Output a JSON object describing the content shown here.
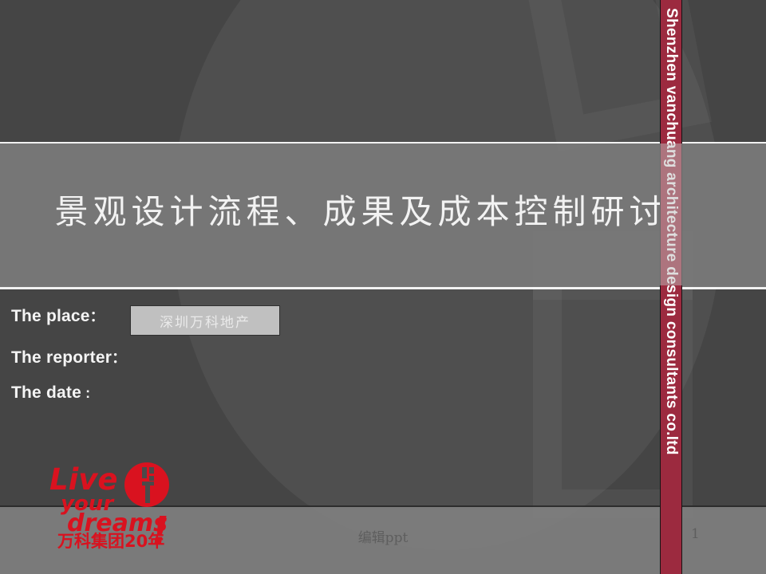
{
  "slide": {
    "title": "景观设计流程、成果及成本控制研讨",
    "background_color": "#454545",
    "band_color": "#7a7a7a",
    "accent_color": "#9c2a3f"
  },
  "side_banner": {
    "text": "Shenzhen  vanchuang architecture design consultants co.ltd",
    "color": "#9c2a3f",
    "text_color": "#ffffff"
  },
  "info": {
    "place_label": "The place",
    "place_colon": "：",
    "place_value": "深圳万科地产",
    "reporter_label": "The reporter",
    "reporter_colon": "：",
    "reporter_value": "",
    "date_label": "The date",
    "date_colon": " :",
    "date_value": ""
  },
  "logo": {
    "line1": "Live",
    "line2": "your",
    "line3": "dreams",
    "exclaim": "!",
    "line4": "万科集团20年",
    "color": "#d9121f"
  },
  "footer": {
    "center_text": "编辑ppt",
    "page_number": "1"
  }
}
